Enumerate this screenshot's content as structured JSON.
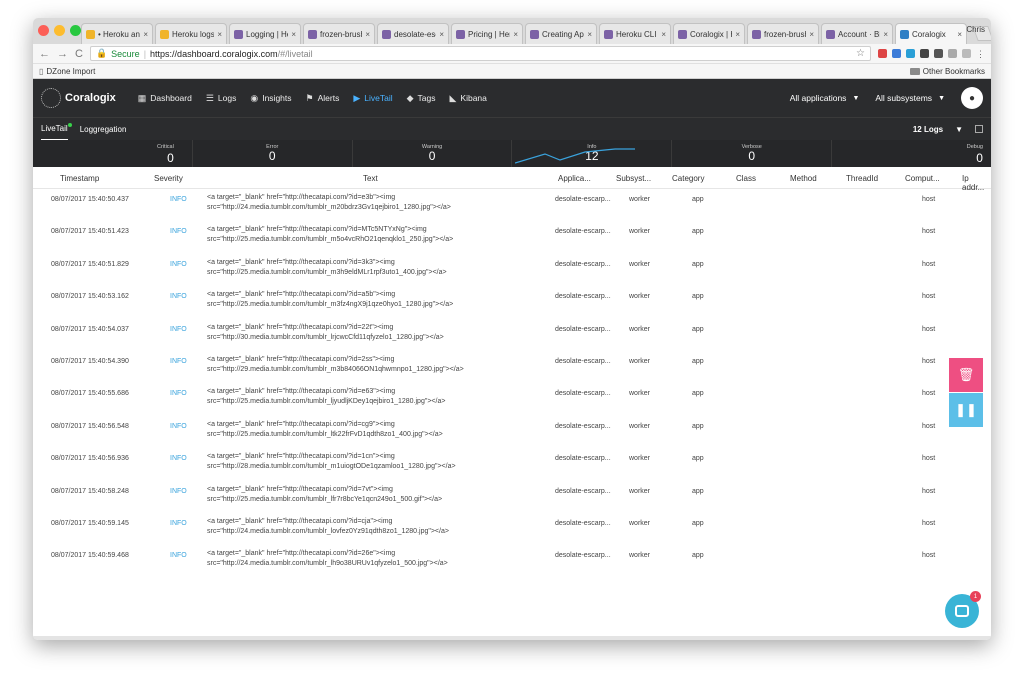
{
  "browser": {
    "tabs": [
      {
        "label": "• Heroku an",
        "fav": "h"
      },
      {
        "label": "Heroku logs",
        "fav": "h"
      },
      {
        "label": "Logging | He",
        "fav": "p"
      },
      {
        "label": "frozen-brush",
        "fav": "p"
      },
      {
        "label": "desolate-esc",
        "fav": "p"
      },
      {
        "label": "Pricing | Her",
        "fav": "p"
      },
      {
        "label": "Creating Ap",
        "fav": "p"
      },
      {
        "label": "Heroku CLI",
        "fav": "p"
      },
      {
        "label": "Coralogix | H",
        "fav": "p"
      },
      {
        "label": "frozen-brush",
        "fav": "p"
      },
      {
        "label": "Account · Bi",
        "fav": "p"
      },
      {
        "label": "Coralogix",
        "fav": "b"
      }
    ],
    "close_glyph": "×",
    "profile": "Chris",
    "secure_label": "Secure",
    "url_host": "https://dashboard.coralogix.com",
    "url_path": "/#/livetail",
    "bookmark": "DZone Import",
    "other_bookmarks": "Other Bookmarks"
  },
  "app": {
    "logo": "Coralogix",
    "nav": [
      {
        "id": "dashboard",
        "label": "Dashboard",
        "icon": "grid-icon",
        "glyph": "▦"
      },
      {
        "id": "logs",
        "label": "Logs",
        "icon": "stack-icon",
        "glyph": "☰"
      },
      {
        "id": "insights",
        "label": "Insights",
        "icon": "target-icon",
        "glyph": "◉"
      },
      {
        "id": "alerts",
        "label": "Alerts",
        "icon": "flag-icon",
        "glyph": "⚑"
      },
      {
        "id": "livetail",
        "label": "LiveTail",
        "icon": "play-icon",
        "glyph": "▶",
        "active": true
      },
      {
        "id": "tags",
        "label": "Tags",
        "icon": "tag-icon",
        "glyph": "◆"
      },
      {
        "id": "kibana",
        "label": "Kibana",
        "icon": "kibana-icon",
        "glyph": "◣"
      }
    ],
    "all_applications": "All applications",
    "all_subsystems": "All subsystems",
    "subtabs": [
      {
        "id": "livetail",
        "label": "LiveTail",
        "active": true
      },
      {
        "id": "loggregation",
        "label": "Loggregation"
      }
    ],
    "log_count": "12 Logs"
  },
  "severity": [
    {
      "id": "critical",
      "label": "Critical",
      "count": "0"
    },
    {
      "id": "error",
      "label": "Error",
      "count": "0"
    },
    {
      "id": "warning",
      "label": "Warning",
      "count": "0"
    },
    {
      "id": "info",
      "label": "Info",
      "count": "12"
    },
    {
      "id": "verbose",
      "label": "Verbose",
      "count": "0"
    },
    {
      "id": "debug",
      "label": "Debug",
      "count": "0"
    }
  ],
  "columns": [
    "Timestamp",
    "Severity",
    "Text",
    "Applica...",
    "Subsyst...",
    "Category",
    "Class",
    "Method",
    "ThreadId",
    "Comput...",
    "Ip addr..."
  ],
  "rows": [
    {
      "ts": "08/07/2017 15:40:50.437",
      "sev": "INFO",
      "t1": "<a target=\"_blank\" href=\"http://thecatapi.com/?id=e3b\"><img",
      "t2": "src=\"http://24.media.tumblr.com/tumblr_m20bdrz3Gv1qejbiro1_1280.jpg\"></a>",
      "app": "desolate-escarp...",
      "sub": "worker",
      "cat": "app",
      "comp": "host"
    },
    {
      "ts": "08/07/2017 15:40:51.423",
      "sev": "INFO",
      "t1": "<a target=\"_blank\" href=\"http://thecatapi.com/?id=MTc5NTYxNg\"><img",
      "t2": "src=\"http://25.media.tumblr.com/tumblr_m5o4vcRhO21qenqklo1_250.jpg\"></a>",
      "app": "desolate-escarp...",
      "sub": "worker",
      "cat": "app",
      "comp": "host"
    },
    {
      "ts": "08/07/2017 15:40:51.829",
      "sev": "INFO",
      "t1": "<a target=\"_blank\" href=\"http://thecatapi.com/?id=3k3\"><img",
      "t2": "src=\"http://25.media.tumblr.com/tumblr_m3h9eldMLr1rpf3uto1_400.jpg\"></a>",
      "app": "desolate-escarp...",
      "sub": "worker",
      "cat": "app",
      "comp": "host"
    },
    {
      "ts": "08/07/2017 15:40:53.162",
      "sev": "INFO",
      "t1": "<a target=\"_blank\" href=\"http://thecatapi.com/?id=a5b\"><img",
      "t2": "src=\"http://25.media.tumblr.com/tumblr_m3fz4ngX9j1qze0hyo1_1280.jpg\"></a>",
      "app": "desolate-escarp...",
      "sub": "worker",
      "cat": "app",
      "comp": "host"
    },
    {
      "ts": "08/07/2017 15:40:54.037",
      "sev": "INFO",
      "t1": "<a target=\"_blank\" href=\"http://thecatapi.com/?id=22t\"><img",
      "t2": "src=\"http://30.media.tumblr.com/tumblr_lrjcwcCfd11qfyzelo1_1280.jpg\"></a>",
      "app": "desolate-escarp...",
      "sub": "worker",
      "cat": "app",
      "comp": "host"
    },
    {
      "ts": "08/07/2017 15:40:54.390",
      "sev": "INFO",
      "t1": "<a target=\"_blank\" href=\"http://thecatapi.com/?id=2ss\"><img",
      "t2": "src=\"http://29.media.tumblr.com/tumblr_m3b84066ON1qhwmnpo1_1280.jpg\"></a>",
      "app": "desolate-escarp...",
      "sub": "worker",
      "cat": "app",
      "comp": "host"
    },
    {
      "ts": "08/07/2017 15:40:55.686",
      "sev": "INFO",
      "t1": "<a target=\"_blank\" href=\"http://thecatapi.com/?id=e63\"><img",
      "t2": "src=\"http://25.media.tumblr.com/tumblr_ljyudljKDey1qejbiro1_1280.jpg\"></a>",
      "app": "desolate-escarp...",
      "sub": "worker",
      "cat": "app",
      "comp": "host"
    },
    {
      "ts": "08/07/2017 15:40:56.548",
      "sev": "INFO",
      "t1": "<a target=\"_blank\" href=\"http://thecatapi.com/?id=cg9\"><img",
      "t2": "src=\"http://25.media.tumblr.com/tumblr_ltk22frFvD1qdth8zo1_400.jpg\"></a>",
      "app": "desolate-escarp...",
      "sub": "worker",
      "cat": "app",
      "comp": "host"
    },
    {
      "ts": "08/07/2017 15:40:56.936",
      "sev": "INFO",
      "t1": "<a target=\"_blank\" href=\"http://thecatapi.com/?id=1cn\"><img",
      "t2": "src=\"http://28.media.tumblr.com/tumblr_m1uiogtODe1qzamloo1_1280.jpg\"></a>",
      "app": "desolate-escarp...",
      "sub": "worker",
      "cat": "app",
      "comp": "host"
    },
    {
      "ts": "08/07/2017 15:40:58.248",
      "sev": "INFO",
      "t1": "<a target=\"_blank\" href=\"http://thecatapi.com/?id=7vt\"><img",
      "t2": "src=\"http://25.media.tumblr.com/tumblr_lfr7r8bcYe1qcn249o1_500.gif\"></a>",
      "app": "desolate-escarp...",
      "sub": "worker",
      "cat": "app",
      "comp": "host"
    },
    {
      "ts": "08/07/2017 15:40:59.145",
      "sev": "INFO",
      "t1": "<a target=\"_blank\" href=\"http://thecatapi.com/?id=cja\"><img",
      "t2": "src=\"http://24.media.tumblr.com/tumblr_lovfez0Yz91qdth8zo1_1280.jpg\"></a>",
      "app": "desolate-escarp...",
      "sub": "worker",
      "cat": "app",
      "comp": "host"
    },
    {
      "ts": "08/07/2017 15:40:59.468",
      "sev": "INFO",
      "t1": "<a target=\"_blank\" href=\"http://thecatapi.com/?id=26e\"><img",
      "t2": "src=\"http://24.media.tumblr.com/tumblr_lh9o38URUv1qfyzelo1_500.jpg\"></a>",
      "app": "desolate-escarp...",
      "sub": "worker",
      "cat": "app",
      "comp": "host"
    }
  ],
  "chat_badge": "1",
  "colors": {
    "accent": "#4ab2ff",
    "info": "#3aa3dd",
    "trash": "#ee4f82",
    "pause": "#5cbfe8",
    "chat": "#39b4d6",
    "header": "#2b2c2e"
  }
}
